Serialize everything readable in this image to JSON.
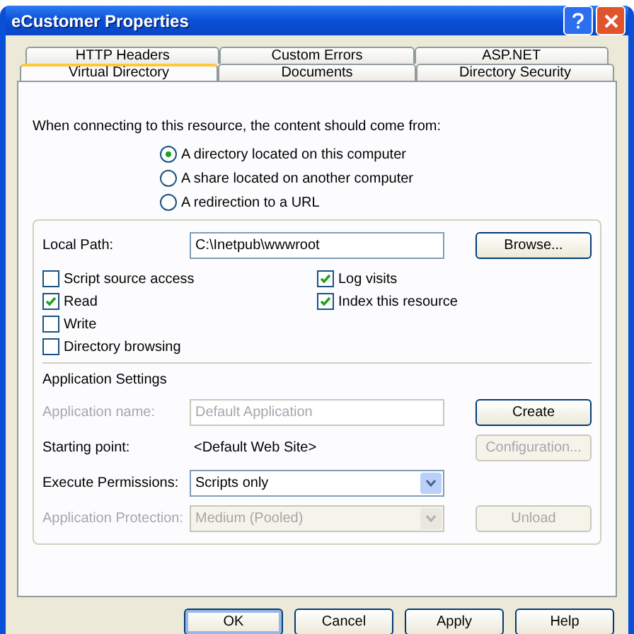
{
  "window": {
    "title": "eCustomer Properties"
  },
  "tab_rows": [
    [
      {
        "label": "HTTP Headers",
        "selected": false
      },
      {
        "label": "Custom Errors",
        "selected": false
      },
      {
        "label": "ASP.NET",
        "selected": false
      }
    ],
    [
      {
        "label": "Virtual Directory",
        "selected": true
      },
      {
        "label": "Documents",
        "selected": false
      },
      {
        "label": "Directory Security",
        "selected": false
      }
    ]
  ],
  "source_prompt": "When connecting to this resource, the content should come from:",
  "source_options": [
    {
      "label": "A directory located on this computer",
      "selected": true
    },
    {
      "label": "A share located on another computer",
      "selected": false
    },
    {
      "label": "A redirection to a URL",
      "selected": false
    }
  ],
  "local_path": {
    "label": "Local Path:",
    "value": "C:\\Inetpub\\wwwroot",
    "button": "Browse..."
  },
  "permissions_left": [
    {
      "label": "Script source access",
      "checked": false
    },
    {
      "label": "Read",
      "checked": true
    },
    {
      "label": "Write",
      "checked": false
    },
    {
      "label": "Directory browsing",
      "checked": false
    }
  ],
  "permissions_right": [
    {
      "label": "Log visits",
      "checked": true
    },
    {
      "label": "Index this resource",
      "checked": true
    }
  ],
  "app_settings": {
    "heading": "Application Settings",
    "rows": [
      {
        "kind": "field",
        "label": "Application name:",
        "value": "Default Application",
        "disabled": true,
        "button": {
          "label": "Create",
          "disabled": false
        }
      },
      {
        "kind": "text",
        "label": "Starting point:",
        "value": "<Default Web Site>",
        "disabled": false,
        "button": {
          "label": "Configuration...",
          "disabled": true
        }
      },
      {
        "kind": "select",
        "label": "Execute Permissions:",
        "value": "Scripts only",
        "disabled": false
      },
      {
        "kind": "select",
        "label": "Application Protection:",
        "value": "Medium (Pooled)",
        "disabled": true,
        "button": {
          "label": "Unload",
          "disabled": true
        }
      }
    ]
  },
  "buttons": [
    {
      "label": "OK",
      "default": true
    },
    {
      "label": "Cancel",
      "default": false
    },
    {
      "label": "Apply",
      "default": false
    },
    {
      "label": "Help",
      "default": false
    }
  ]
}
